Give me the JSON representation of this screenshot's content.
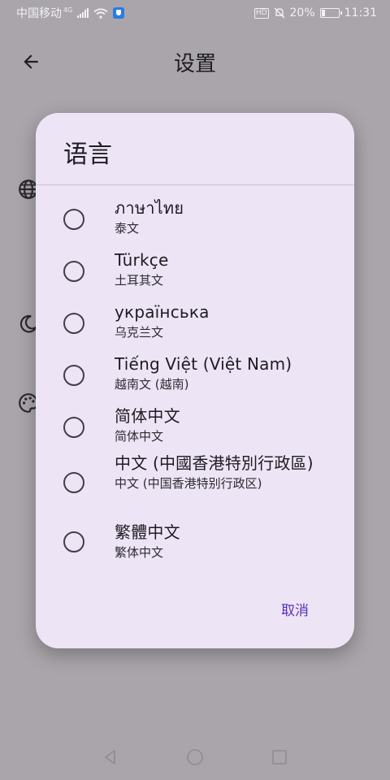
{
  "status_bar": {
    "carrier": "中国移动",
    "network": "4G",
    "battery": "20%",
    "battery_level": 0.2,
    "time": "11:31",
    "hd": "HD"
  },
  "app_bar": {
    "title": "设置"
  },
  "dialog": {
    "title": "语言",
    "options": [
      {
        "primary": "ภาษาไทย",
        "secondary": "泰文"
      },
      {
        "primary": "Türkçe",
        "secondary": "土耳其文"
      },
      {
        "primary": "українська",
        "secondary": "乌克兰文"
      },
      {
        "primary": "Tiếng Việt (Việt Nam)",
        "secondary": "越南文 (越南)"
      },
      {
        "primary": "简体中文",
        "secondary": "简体中文"
      },
      {
        "primary": "中文 (中國香港特別行政區)",
        "secondary": "中文 (中国香港特别行政区)"
      },
      {
        "primary": "繁體中文",
        "secondary": "繁体中文"
      }
    ],
    "cancel_label": "取消"
  },
  "colors": {
    "accent": "#5b2fb8",
    "dialog_bg": "#ede5f6",
    "scrim_bg": "#a9a5ab"
  }
}
